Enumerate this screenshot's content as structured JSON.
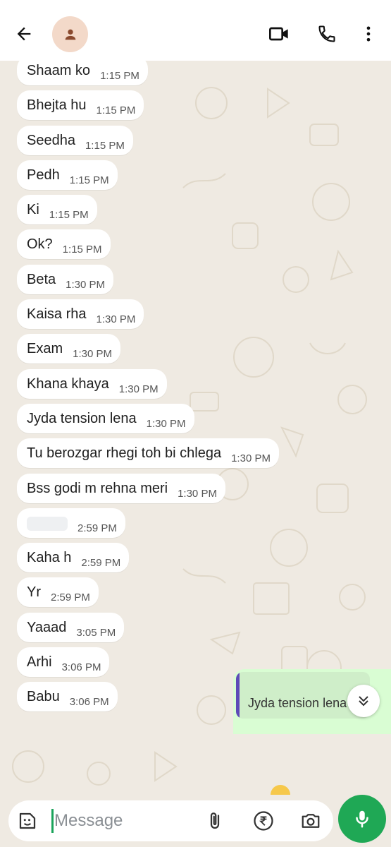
{
  "header": {
    "back_icon": "arrow-left-icon",
    "avatar_icon": "person-icon",
    "video_icon": "video-camera-icon",
    "call_icon": "phone-icon",
    "menu_icon": "more-vertical-icon"
  },
  "messages": [
    {
      "text": "Shaam ko",
      "time": "1:15 PM"
    },
    {
      "text": "Bhejta hu",
      "time": "1:15 PM"
    },
    {
      "text": "Seedha",
      "time": "1:15 PM"
    },
    {
      "text": "Pedh",
      "time": "1:15 PM"
    },
    {
      "text": "Ki",
      "time": "1:15 PM"
    },
    {
      "text": "Ok?",
      "time": "1:15 PM"
    },
    {
      "text": "Beta",
      "time": "1:30 PM"
    },
    {
      "text": "Kaisa rha",
      "time": "1:30 PM"
    },
    {
      "text": "Exam",
      "time": "1:30 PM"
    },
    {
      "text": "Khana khaya",
      "time": "1:30 PM"
    },
    {
      "text": "Jyda tension lena",
      "time": "1:30 PM"
    },
    {
      "text": "Tu berozgar rhegi toh bi chlega",
      "time": "1:30 PM"
    },
    {
      "text": "Bss godi m rehna meri",
      "time": "1:30 PM"
    },
    {
      "text": "",
      "time": "2:59 PM"
    },
    {
      "text": "Kaha h",
      "time": "2:59 PM"
    },
    {
      "text": "Yr",
      "time": "2:59 PM"
    },
    {
      "text": "Yaaad",
      "time": "3:05 PM"
    },
    {
      "text": "Arhi",
      "time": "3:06 PM"
    },
    {
      "text": "Babu",
      "time": "3:06 PM"
    }
  ],
  "reply_preview": {
    "text": "Jyda tension lena"
  },
  "composer": {
    "placeholder": "Message",
    "emoji_icon": "emoji-sticker-icon",
    "attach_icon": "paperclip-icon",
    "payment_icon": "rupee-icon",
    "camera_icon": "camera-icon",
    "mic_icon": "microphone-icon"
  },
  "colors": {
    "chat_bg": "#efeae2",
    "incoming_bubble": "#ffffff",
    "outgoing_bubble": "#d9fdd3",
    "accent": "#1fa855",
    "quote_bar": "#5d4ab8"
  }
}
